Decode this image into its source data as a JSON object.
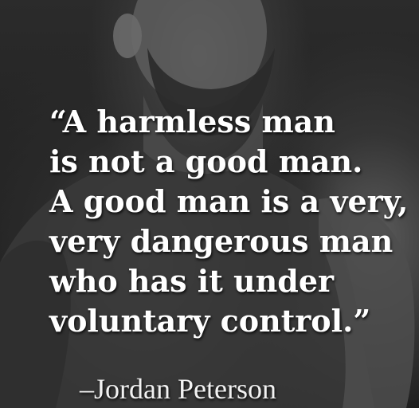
{
  "quote": {
    "lines": [
      "“A harmless man",
      "is not a good man.",
      "A good man is a very,",
      "very dangerous man",
      "who has it under",
      "voluntary control.”"
    ]
  },
  "attribution": "–Jordan Peterson"
}
